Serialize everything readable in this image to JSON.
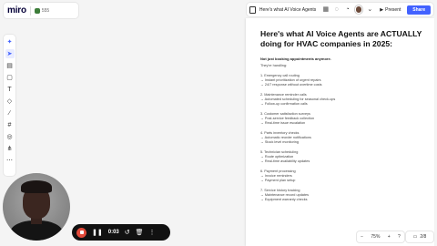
{
  "app": {
    "logo": "miro",
    "board_count": "555"
  },
  "topbar": {
    "doc_title": "Here's what AI Voice Agents",
    "present_label": "Present",
    "share_label": "Share",
    "icons": [
      "doc-icon",
      "grid-icon",
      "comment-icon",
      "timer-icon",
      "avatar",
      "chevron-down-icon",
      "play-icon"
    ]
  },
  "toolbar": {
    "tools": [
      {
        "name": "ai-sparkle-icon"
      },
      {
        "name": "select-cursor-icon"
      },
      {
        "name": "template-icon"
      },
      {
        "name": "sticky-note-icon"
      },
      {
        "name": "text-icon"
      },
      {
        "name": "shapes-icon"
      },
      {
        "name": "pen-icon"
      },
      {
        "name": "frame-icon"
      },
      {
        "name": "comment-icon"
      },
      {
        "name": "mindmap-icon"
      },
      {
        "name": "more-icon"
      }
    ]
  },
  "document": {
    "heading": "Here's what AI Voice Agents are ACTUALLY doing for HVAC companies in 2025:",
    "subheading": "Not just booking appointments anymore.",
    "intro": "They're handling:",
    "sections": [
      {
        "lines": [
          "1. Emergency call routing",
          "→ Instant prioritization of urgent repairs",
          "→ 24/7 response without overtime costs"
        ]
      },
      {
        "lines": [
          "2. Maintenance reminder calls",
          "→ Automated scheduling for seasonal check-ups",
          "→ Follow-up confirmation calls"
        ]
      },
      {
        "lines": [
          "3. Customer satisfaction surveys",
          "→ Post-service feedback collection",
          "→ Real-time issue escalation"
        ]
      },
      {
        "lines": [
          "4. Parts inventory checks",
          "→ Automatic reorder notifications",
          "→ Stock level monitoring"
        ]
      },
      {
        "lines": [
          "5. Technician scheduling",
          "→ Route optimization",
          "→ Real-time availability updates"
        ]
      },
      {
        "lines": [
          "6. Payment processing",
          "→ Invoice reminders",
          "→ Payment plan setup"
        ]
      },
      {
        "lines": [
          "7. Service history tracking",
          "→ Maintenance record updates",
          "→ Equipment warranty checks"
        ]
      }
    ]
  },
  "recorder": {
    "time": "0:03"
  },
  "zoom": {
    "value": "75%",
    "page": "2/8"
  }
}
